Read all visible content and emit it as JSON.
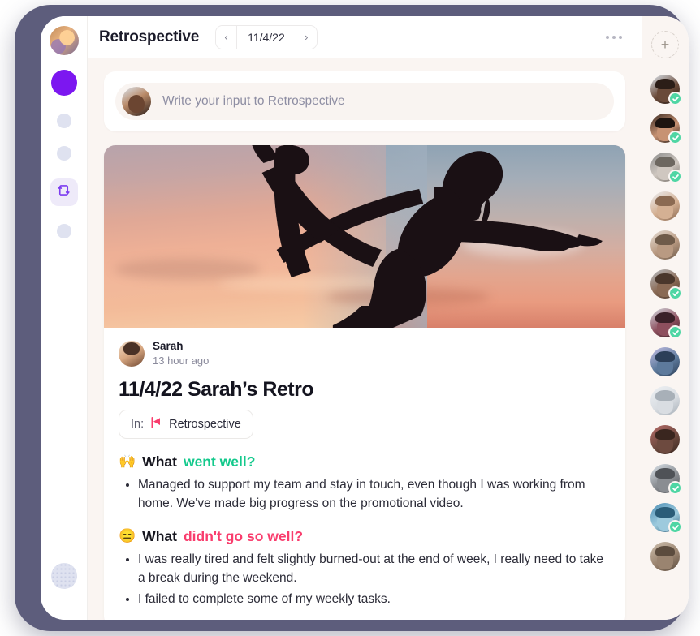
{
  "app": {
    "frame_color": "#5d5d7c",
    "accent_color": "#7c17f0",
    "background_color": "#faf5f2"
  },
  "left_rail": {
    "workspace_avatar_name": "workspace-avatar",
    "items": [
      {
        "name": "workspace-active-dot",
        "type": "dot-active"
      },
      {
        "name": "nav-dot-1",
        "type": "dot"
      },
      {
        "name": "nav-dot-2",
        "type": "dot"
      },
      {
        "name": "retrospective-icon",
        "type": "icon"
      },
      {
        "name": "nav-dot-3",
        "type": "dot"
      }
    ],
    "bottom_avatar_name": "user-account-avatar"
  },
  "header": {
    "title": "Retrospective",
    "prev_label": "‹",
    "next_label": "›",
    "date": "11/4/22",
    "more_menu_label": "•••"
  },
  "composer": {
    "placeholder": "Write your input to Retrospective",
    "avatar_name": "composer-user-avatar"
  },
  "post": {
    "hero_alt": "yoga-silhouette-sunset-photo",
    "author": "Sarah",
    "time": "13 hour ago",
    "title": "11/4/22 Sarah’s Retro",
    "in_label": "In:",
    "in_channel": "Retrospective",
    "sections": [
      {
        "emoji": "🙌",
        "emoji_name": "raised-hands-emoji",
        "prefix": "What ",
        "highlight": "went well?",
        "highlight_color": "#14c98c",
        "bullets": [
          "Managed to support my team and stay in touch, even though I was working from home. We've made big progress on the promotional video."
        ]
      },
      {
        "emoji": "😑",
        "emoji_name": "expressionless-face-emoji",
        "prefix": "What ",
        "highlight": "didn't go so well?",
        "highlight_color": "#f93d6d",
        "bullets": [
          "I was really tired and felt slightly burned-out at the end of week, I really need to take a break during the weekend.",
          "I failed to complete some of my weekly tasks."
        ]
      }
    ]
  },
  "right_rail": {
    "add_label": "+",
    "members": [
      {
        "name": "member-1",
        "checked": true,
        "c1": "#dfe9f2",
        "c2": "#6a4a39",
        "c3": "#2b1d17"
      },
      {
        "name": "member-2",
        "checked": true,
        "c1": "#3a2a22",
        "c2": "#c79273",
        "c3": "#1d1410"
      },
      {
        "name": "member-3",
        "checked": true,
        "c1": "#8c8c8c",
        "c2": "#cfc7c0",
        "c3": "#6d6760"
      },
      {
        "name": "member-4",
        "checked": false,
        "c1": "#eceef2",
        "c2": "#d4b093",
        "c3": "#8b6a52"
      },
      {
        "name": "member-5",
        "checked": false,
        "c1": "#e6ddd5",
        "c2": "#b99a82",
        "c3": "#6f5b4a"
      },
      {
        "name": "member-6",
        "checked": true,
        "c1": "#b9bdc2",
        "c2": "#8a6a55",
        "c3": "#4a372c"
      },
      {
        "name": "member-7",
        "checked": true,
        "c1": "#d5dbe2",
        "c2": "#8d4f5e",
        "c3": "#3a2129"
      },
      {
        "name": "member-8",
        "checked": false,
        "c1": "#c3bee4",
        "c2": "#5d7a9c",
        "c3": "#2c3f58"
      },
      {
        "name": "member-9",
        "checked": false,
        "c1": "#eef1f4",
        "c2": "#d9dde2",
        "c3": "#a8b0b8"
      },
      {
        "name": "member-10",
        "checked": false,
        "c1": "#b76b68",
        "c2": "#6d4a3f",
        "c3": "#3a261f"
      },
      {
        "name": "member-11",
        "checked": true,
        "c1": "#dbe3ea",
        "c2": "#8a8d92",
        "c3": "#4f5257"
      },
      {
        "name": "member-12",
        "checked": true,
        "c1": "#4f8fb5",
        "c2": "#9dcadd",
        "c3": "#2a5c78"
      },
      {
        "name": "member-13",
        "checked": false,
        "c1": "#cdbfae",
        "c2": "#9a8470",
        "c3": "#5c4c3e"
      }
    ]
  }
}
